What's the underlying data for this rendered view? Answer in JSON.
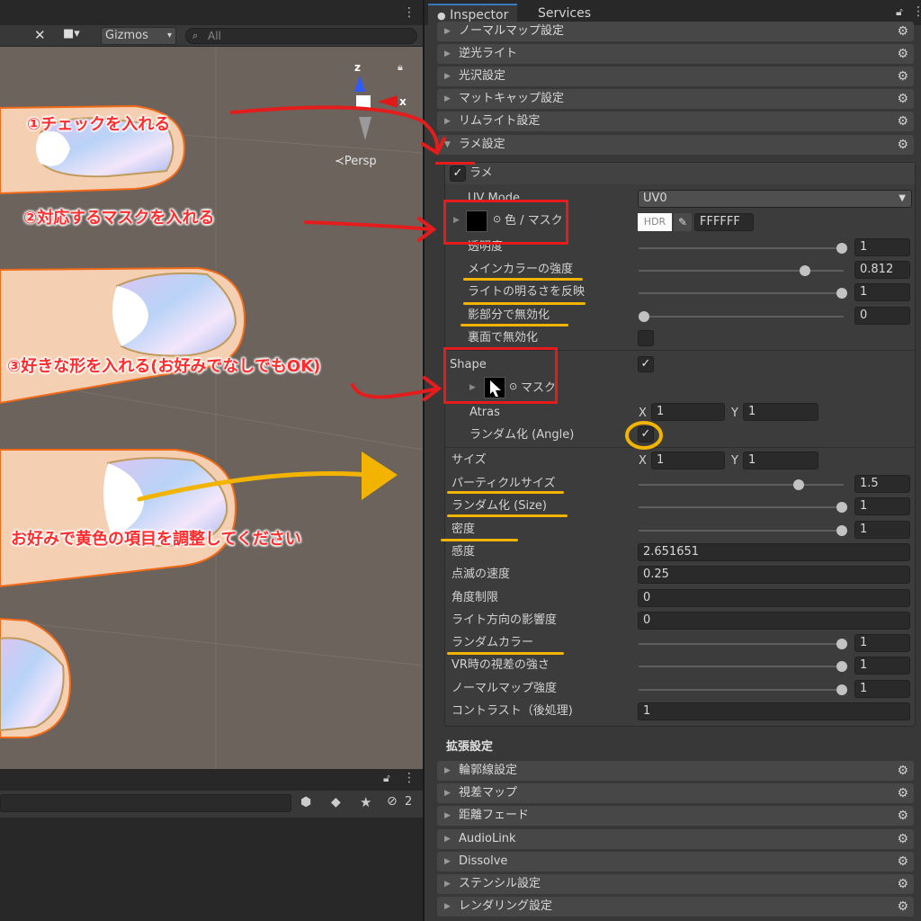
{
  "scene_toolbar": {
    "gizmos_label": "Gizmos",
    "search_placeholder": "All",
    "persp_label": "≺Persp",
    "axis_z": "z",
    "axis_x": "x"
  },
  "hierarchy": {
    "hidden_count": "2"
  },
  "inspector": {
    "tabs": [
      "Inspector",
      "Services"
    ],
    "top_sections": [
      "ノーマルマップ設定",
      "逆光ライト",
      "光沢設定",
      "マットキャップ設定",
      "リムライト設定",
      "ラメ設定"
    ],
    "rame_toggle": "ラメ",
    "uv_mode_label": "UV Mode",
    "uv_mode_value": "UV0",
    "color_mask_label": "色 / マスク",
    "hdr_label": "HDR",
    "color_hex": "FFFFFF",
    "props": [
      {
        "label": "透明度",
        "value": "1",
        "knob": 1.0
      },
      {
        "label": "メインカラーの強度",
        "value": "0.812",
        "knob": 0.812
      },
      {
        "label": "ライトの明るさを反映",
        "value": "1",
        "knob": 1.0
      },
      {
        "label": "影部分で無効化",
        "value": "0",
        "knob": 0.0
      }
    ],
    "backface_label": "裏面で無効化",
    "shape_label": "Shape",
    "shape_mask_label": "マスク",
    "atras_label": "Atras",
    "atras_x": "1",
    "atras_y": "1",
    "random_angle_label": "ランダム化 (Angle)",
    "size_label": "サイズ",
    "size_x": "1",
    "size_y": "1",
    "xy_x": "X",
    "xy_y": "Y",
    "props2": [
      {
        "label": "パーティクルサイズ",
        "value": "1.5",
        "slider": true,
        "knob": 0.78
      },
      {
        "label": "ランダム化 (Size)",
        "value": "1",
        "slider": true,
        "knob": 1.0
      },
      {
        "label": "密度",
        "value": "1",
        "slider": true,
        "knob": 1.0
      },
      {
        "label": "感度",
        "value": "2.651651",
        "slider": false
      },
      {
        "label": "点滅の速度",
        "value": "0.25",
        "slider": false
      },
      {
        "label": "角度制限",
        "value": "0",
        "slider": false
      },
      {
        "label": "ライト方向の影響度",
        "value": "0",
        "slider": false
      },
      {
        "label": "ランダムカラー",
        "value": "1",
        "slider": true,
        "knob": 1.0
      },
      {
        "label": "VR時の視差の強さ",
        "value": "1",
        "slider": true,
        "knob": 1.0
      },
      {
        "label": "ノーマルマップ強度",
        "value": "1",
        "slider": true,
        "knob": 1.0
      },
      {
        "label": "コントラスト（後処理)",
        "value": "1",
        "slider": false
      }
    ],
    "ext_heading": "拡張設定",
    "ext_sections": [
      "輪郭線設定",
      "視差マップ",
      "距離フェード",
      "AudioLink",
      "Dissolve",
      "ステンシル設定",
      "レンダリング設定"
    ]
  },
  "annotations": {
    "step1": "①チェックを入れる",
    "step2": "②対応するマスクを入れる",
    "step3": "③好きな形を入れる(お好みでなしでもOK)",
    "yellow_note": "お好みで黄色の項目を調整してください"
  },
  "colors": {
    "red": "#e51c1c",
    "yellow": "#f2b400",
    "panel": "#383838"
  }
}
